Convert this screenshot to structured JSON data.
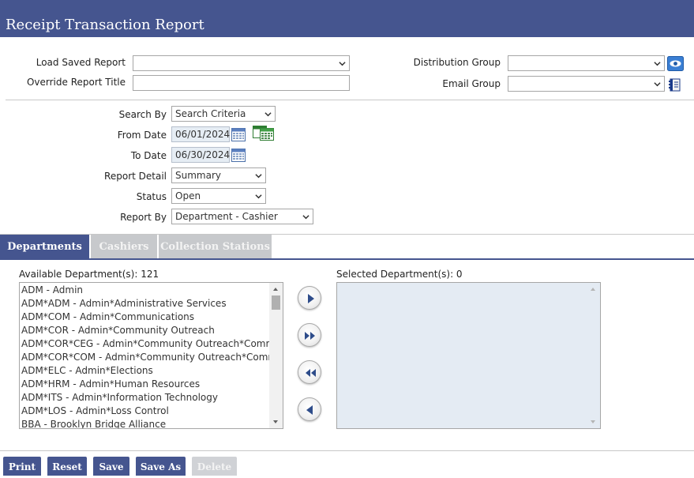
{
  "header": {
    "title": "Receipt Transaction Report"
  },
  "top_form": {
    "load_saved_report": {
      "label": "Load Saved Report",
      "value": ""
    },
    "override_title": {
      "label": "Override Report Title",
      "value": ""
    },
    "distribution_group": {
      "label": "Distribution Group",
      "value": "",
      "icon": "view-eye-icon"
    },
    "email_group": {
      "label": "Email Group",
      "value": "",
      "icon": "address-book-icon"
    }
  },
  "criteria": {
    "search_by": {
      "label": "Search By",
      "value": "Search Criteria"
    },
    "from_date": {
      "label": "From Date",
      "value": "06/01/2024"
    },
    "to_date": {
      "label": "To Date",
      "value": "06/30/2024"
    },
    "report_detail": {
      "label": "Report Detail",
      "value": "Summary"
    },
    "status": {
      "label": "Status",
      "value": "Open"
    },
    "report_by": {
      "label": "Report By",
      "value": "Department - Cashier"
    }
  },
  "tabs": [
    {
      "label": "Departments",
      "active": true
    },
    {
      "label": "Cashiers",
      "active": false
    },
    {
      "label": "Collection Stations",
      "active": false
    }
  ],
  "departments": {
    "available_label": "Available Department(s): 121",
    "selected_label": "Selected Department(s): 0",
    "available_items": [
      "ADM - Admin",
      "ADM*ADM - Admin*Administrative Services",
      "ADM*COM - Admin*Communications",
      "ADM*COR - Admin*Community Outreach",
      "ADM*COR*CEG - Admin*Community Outreach*Community",
      "ADM*COR*COM - Admin*Community Outreach*Communic",
      "ADM*ELC - Admin*Elections",
      "ADM*HRM - Admin*Human Resources",
      "ADM*ITS - Admin*Information Technology",
      "ADM*LOS - Admin*Loss Control",
      "BBA - Brooklyn Bridge Alliance"
    ],
    "selected_items": []
  },
  "actions": {
    "print": "Print",
    "reset": "Reset",
    "save": "Save",
    "save_as": "Save As",
    "delete": "Delete"
  },
  "colors": {
    "brand": "#45558f",
    "disabled": "#d0d2d6",
    "date_field_bg": "#e6edf4",
    "selected_list_bg": "#e4ebf3"
  }
}
